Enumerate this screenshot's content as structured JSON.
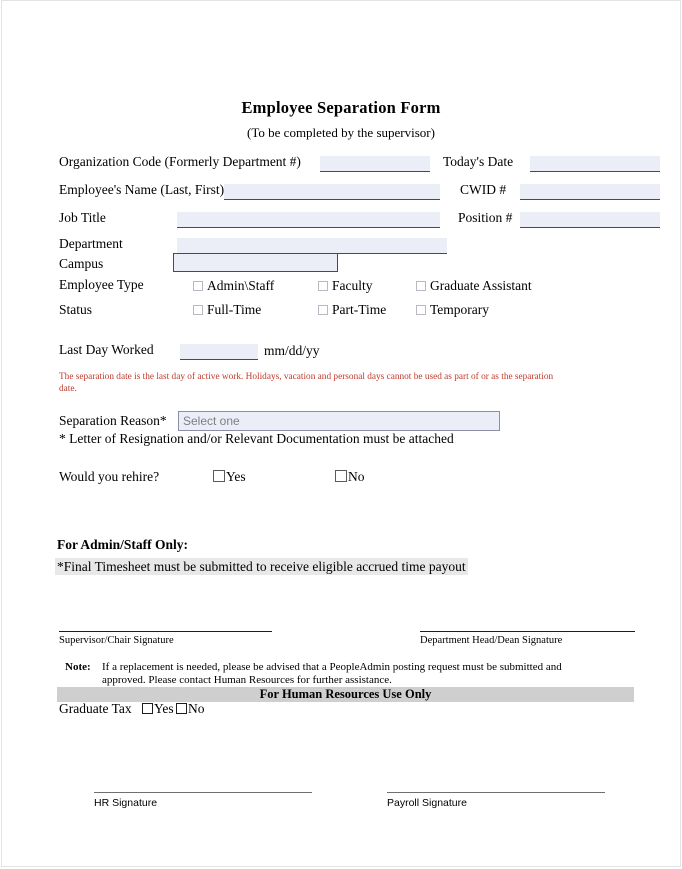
{
  "header": {
    "title": "Employee Separation Form",
    "subtitle": "(To be completed by the supervisor)"
  },
  "fields": {
    "org_code_label": "Organization Code (Formerly Department #)",
    "org_code_value": "",
    "todays_date_label": "Today's Date",
    "todays_date_value": "",
    "employee_name_label": "Employee's Name (Last, First)",
    "employee_name_value": "",
    "cwid_label": "CWID #",
    "cwid_value": "",
    "job_title_label": "Job Title",
    "job_title_value": "",
    "position_label": "Position #",
    "position_value": "",
    "department_label": "Department",
    "department_value": "",
    "campus_label": "Campus",
    "campus_value": ""
  },
  "employee_type": {
    "label": "Employee Type",
    "options": [
      "Admin\\Staff",
      "Faculty",
      "Graduate Assistant"
    ]
  },
  "status": {
    "label": "Status",
    "options": [
      "Full-Time",
      "Part-Time",
      "Temporary"
    ]
  },
  "last_day": {
    "label": "Last Day Worked",
    "value": "",
    "format_hint": "mm/dd/yy"
  },
  "warning": "The separation date is the last day of active work. Holidays, vacation and personal days cannot be used as part of or as the separation date.",
  "separation": {
    "label": "Separation Reason*",
    "placeholder": "Select one",
    "value": "",
    "footnote": "* Letter of Resignation and/or Relevant Documentation must be attached"
  },
  "rehire": {
    "label": "Would you rehire?",
    "yes": "Yes",
    "no": "No"
  },
  "admin_staff": {
    "heading": "For Admin/Staff Only:",
    "highlight": "*Final Timesheet must be submitted to receive eligible accrued time payout"
  },
  "signatures": {
    "supervisor": "Supervisor/Chair Signature",
    "department_head": "Department Head/Dean Signature",
    "hr": "HR Signature",
    "payroll": "Payroll Signature"
  },
  "note": {
    "label": "Note:",
    "line1": "If a replacement is needed, please be advised that a PeopleAdmin posting request must be submitted and",
    "line2": "approved. Please contact Human Resources for further assistance."
  },
  "hr_section": {
    "band_title": "For Human Resources Use Only",
    "graduate_tax_label": "Graduate Tax",
    "yes": "Yes",
    "no": "No"
  },
  "colors": {
    "field_fill": "#eceef7",
    "warning_red": "#c0392b",
    "band_grey": "#cfcfcf",
    "highlight_grey": "#e8e8e8"
  }
}
